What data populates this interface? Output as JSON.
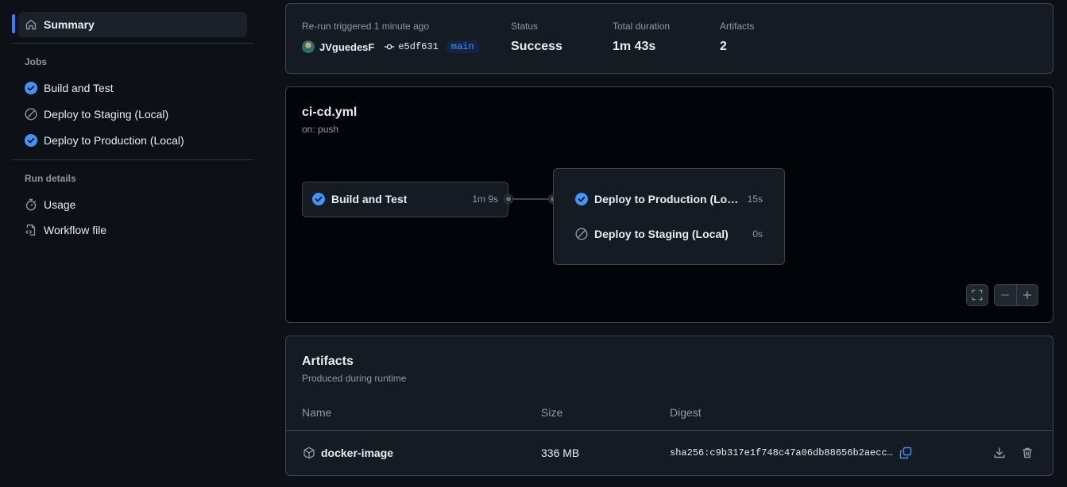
{
  "sidebar": {
    "summary_label": "Summary",
    "jobs_heading": "Jobs",
    "jobs": [
      {
        "label": "Build and Test",
        "status": "success"
      },
      {
        "label": "Deploy to Staging (Local)",
        "status": "skipped"
      },
      {
        "label": "Deploy to Production (Local)",
        "status": "success"
      }
    ],
    "run_details_heading": "Run details",
    "details": [
      {
        "label": "Usage",
        "icon": "stopwatch-icon"
      },
      {
        "label": "Workflow file",
        "icon": "file-code-icon"
      }
    ]
  },
  "summary": {
    "trigger_label": "Re-run triggered 1 minute ago",
    "actor": "JVguedesF",
    "commit": "e5df631",
    "branch": "main",
    "status_label": "Status",
    "status_value": "Success",
    "duration_label": "Total duration",
    "duration_value": "1m 43s",
    "artifacts_label": "Artifacts",
    "artifacts_value": "2"
  },
  "workflow": {
    "file": "ci-cd.yml",
    "trigger": "on: push",
    "build_job": {
      "name": "Build and Test",
      "duration": "1m 9s"
    },
    "deploy_jobs": [
      {
        "name": "Deploy to Production (Local)",
        "duration": "15s",
        "status": "success"
      },
      {
        "name": "Deploy to Staging (Local)",
        "duration": "0s",
        "status": "skipped"
      }
    ]
  },
  "artifacts": {
    "title": "Artifacts",
    "subtitle": "Produced during runtime",
    "columns": {
      "name": "Name",
      "size": "Size",
      "digest": "Digest"
    },
    "rows": [
      {
        "name": "docker-image",
        "size": "336 MB",
        "digest": "sha256:c9b317e1f748c47a06db88656b2aecc…"
      }
    ]
  },
  "colors": {
    "accent": "#2f81f7",
    "success": "#4493f8",
    "background": "#0d1117"
  }
}
